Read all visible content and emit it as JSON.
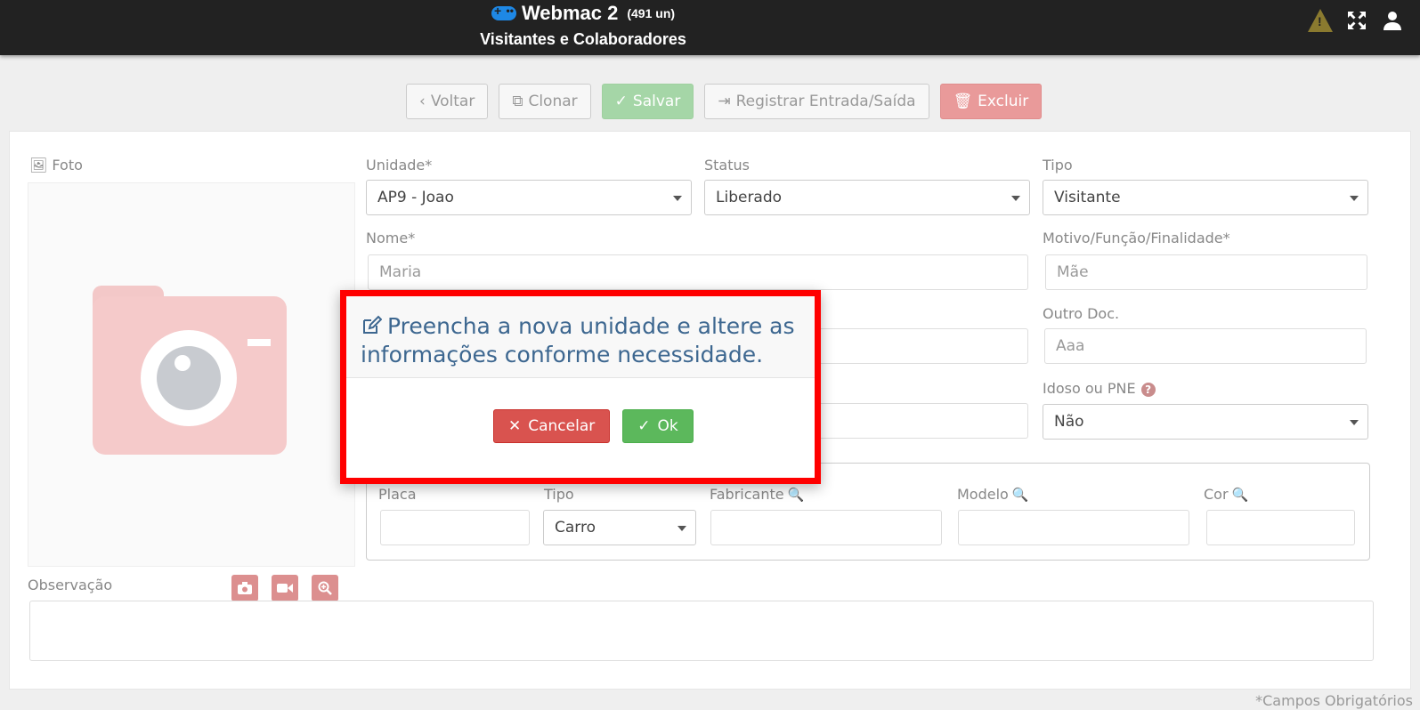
{
  "header": {
    "app_name": "Webmac 2",
    "count": "(491 un)",
    "subtitle": "Visitantes e Colaboradores"
  },
  "toolbar": {
    "back_label": "Voltar",
    "clone_label": "Clonar",
    "save_label": "Salvar",
    "register_label": "Registrar Entrada/Saída",
    "delete_label": "Excluir"
  },
  "form": {
    "photo_label": "Foto",
    "unidade_label": "Unidade*",
    "unidade_value": "AP9 - Joao",
    "status_label": "Status",
    "status_value": "Liberado",
    "tipo_label": "Tipo",
    "tipo_value": "Visitante",
    "nome_label": "Nome*",
    "nome_value": "Maria",
    "motivo_label": "Motivo/Função/Finalidade*",
    "motivo_value": "Mãe",
    "outro_doc_label": "Outro Doc.",
    "outro_doc_value": "Aaa",
    "idoso_label": "Idoso ou PNE",
    "idoso_help": "?",
    "idoso_value": "Não",
    "vehicle": {
      "placa_label": "Placa",
      "tipo_label": "Tipo",
      "tipo_value": "Carro",
      "fabricante_label": "Fabricante",
      "modelo_label": "Modelo",
      "cor_label": "Cor"
    },
    "observacao_label": "Observação",
    "required_note": "*Campos Obrigatórios"
  },
  "modal": {
    "message": "Preencha a nova unidade e altere as informações conforme necessidade.",
    "cancel_label": "Cancelar",
    "ok_label": "Ok"
  },
  "colors": {
    "topbar": "#222222",
    "save": "#a5d6a7",
    "delete": "#e99a9a",
    "modal_highlight": "#ff0000",
    "cancel": "#d9534f",
    "ok": "#5cb85c"
  }
}
